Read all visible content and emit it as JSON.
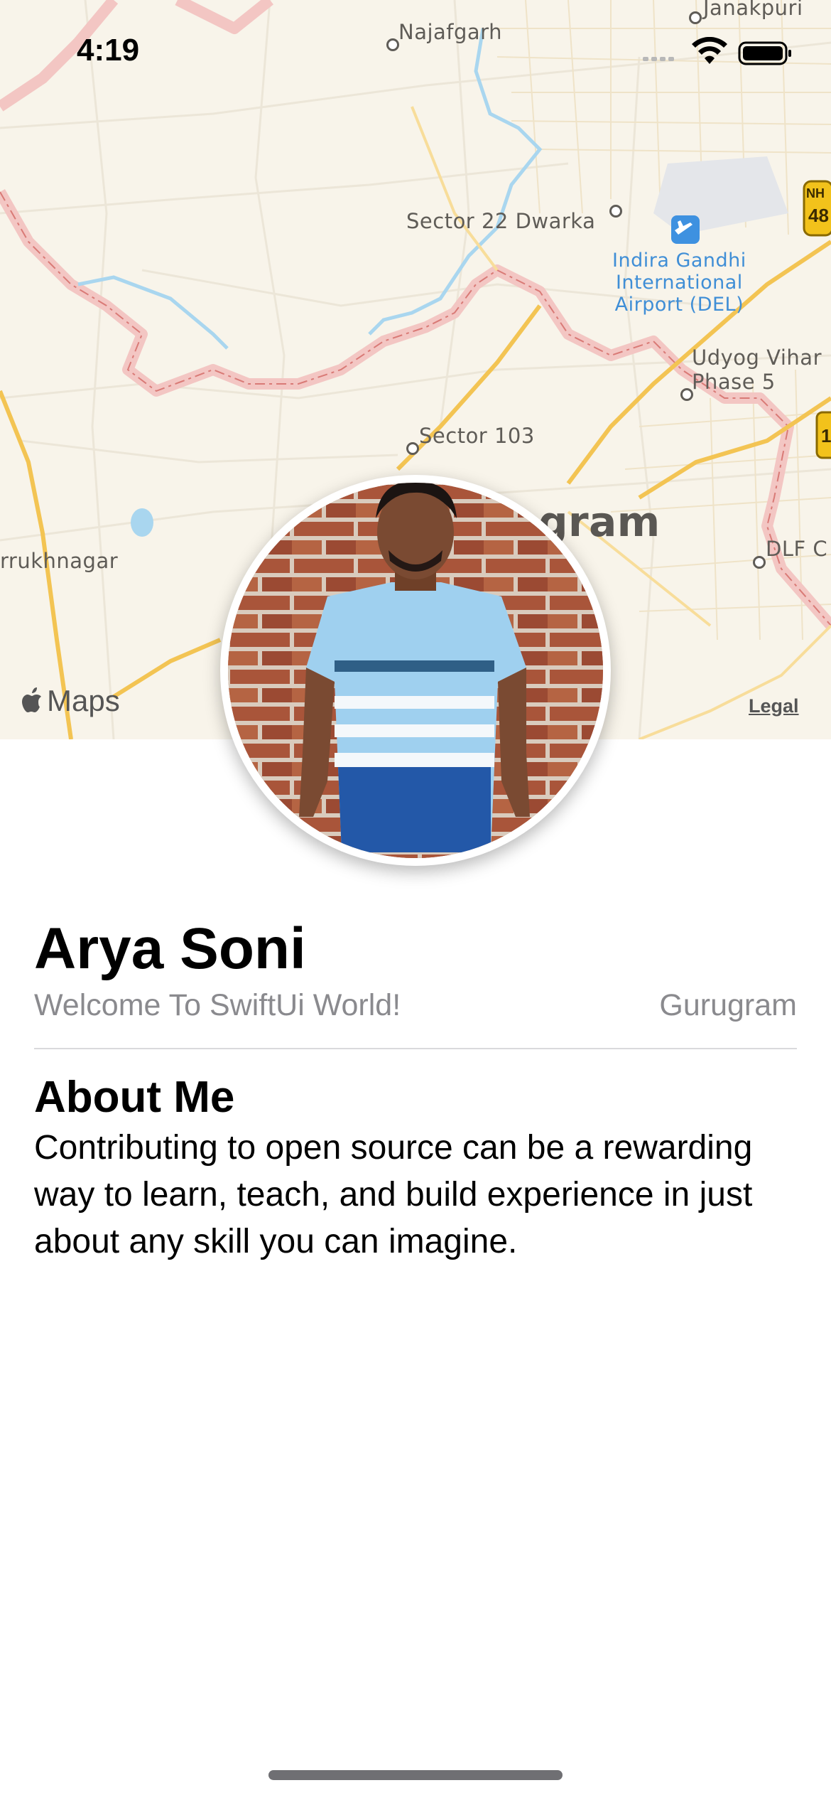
{
  "status_bar": {
    "time": "4:19"
  },
  "map": {
    "places": [
      {
        "id": "najafgarh",
        "label": "Najafgarh"
      },
      {
        "id": "janakpuri",
        "label": "Janakpuri"
      },
      {
        "id": "dwarka",
        "label": "Sector 22 Dwarka"
      },
      {
        "id": "airport",
        "label": "Indira Gandhi\nInternational\nAirport (DEL)"
      },
      {
        "id": "udyog",
        "label": "Udyog Vihar\nPhase 5"
      },
      {
        "id": "sector103",
        "label": "Sector 103"
      },
      {
        "id": "city",
        "label": "gram"
      },
      {
        "id": "farrukhnagar",
        "label": "rrukhnagar"
      },
      {
        "id": "dlf",
        "label": "DLF C"
      }
    ],
    "highway_labels": [
      "NH",
      "48",
      "1"
    ],
    "logo_text": "Maps",
    "legal_label": "Legal"
  },
  "profile": {
    "name": "Arya Soni",
    "subtitle": "Welcome To SwiftUi World!",
    "location": "Gurugram"
  },
  "about": {
    "title": "About Me",
    "text": "Contributing to open source can be a rewarding way to learn, teach, and build experience in just about any skill you can imagine."
  }
}
